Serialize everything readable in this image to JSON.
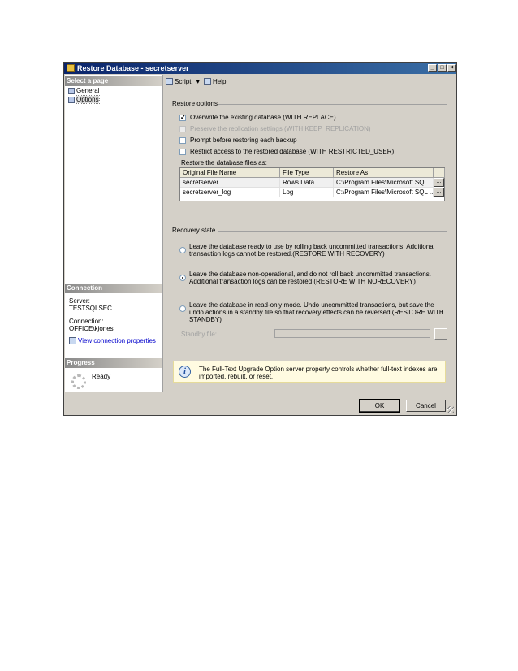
{
  "window": {
    "title": "Restore Database - secretserver",
    "controls": {
      "minimize": "_",
      "maximize": "□",
      "close": "×"
    }
  },
  "left_pane": {
    "select_page_header": "Select a page",
    "pages": [
      {
        "label": "General",
        "icon": "page-icon",
        "selected": false
      },
      {
        "label": "Options",
        "icon": "page-icon",
        "selected": true
      }
    ],
    "connection_header": "Connection",
    "server_label": "Server:",
    "server_value": "TESTSQLSEC",
    "connection_label": "Connection:",
    "connection_value": "OFFICE\\kjones",
    "view_connection_link": "View connection properties",
    "progress_header": "Progress",
    "progress_status": "Ready"
  },
  "toolbar": {
    "script_label": "Script",
    "script_arrow": "▾",
    "help_label": "Help"
  },
  "restore_options": {
    "group_label": "Restore options",
    "checkboxes": [
      {
        "label": "Overwrite the existing database (WITH REPLACE)",
        "checked": true,
        "enabled": true
      },
      {
        "label": "Preserve the replication settings (WITH KEEP_REPLICATION)",
        "checked": false,
        "enabled": false
      },
      {
        "label": "Prompt before restoring each backup",
        "checked": false,
        "enabled": true
      },
      {
        "label": "Restrict access to the restored database (WITH RESTRICTED_USER)",
        "checked": false,
        "enabled": true
      }
    ],
    "files_label": "Restore the database files as:",
    "files_table": {
      "columns": [
        "Original File Name",
        "File Type",
        "Restore As"
      ],
      "rows": [
        {
          "original": "secretserver",
          "type": "Rows Data",
          "restore_as": "C:\\Program Files\\Microsoft SQL ..."
        },
        {
          "original": "secretserver_log",
          "type": "Log",
          "restore_as": "C:\\Program Files\\Microsoft SQL ..."
        }
      ],
      "browse_label": "..."
    }
  },
  "recovery_state": {
    "group_label": "Recovery state",
    "options": [
      {
        "label": "Leave the database ready to use by rolling back uncommitted transactions. Additional transaction logs cannot be restored.(RESTORE WITH RECOVERY)",
        "selected": false
      },
      {
        "label": "Leave the database non-operational, and do not roll back uncommitted transactions. Additional transaction logs can be restored.(RESTORE WITH NORECOVERY)",
        "selected": true
      },
      {
        "label": "Leave the database in read-only mode. Undo uncommitted transactions, but save the undo actions in a standby file so that recovery effects can be reversed.(RESTORE WITH STANDBY)",
        "selected": false
      }
    ],
    "standby_label": "Standby file:",
    "standby_value": ""
  },
  "notice": {
    "icon": "info-icon",
    "text": "The Full-Text Upgrade Option server property controls whether full-text indexes are imported, rebuilt, or reset."
  },
  "buttons": {
    "ok": "OK",
    "cancel": "Cancel"
  }
}
